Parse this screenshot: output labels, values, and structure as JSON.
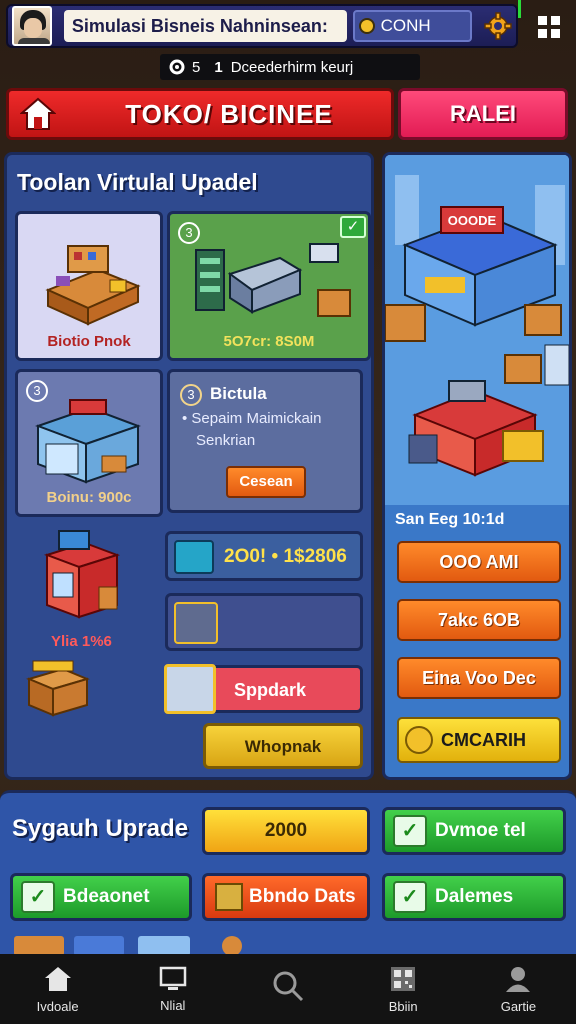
{
  "topbar": {
    "title": "Simulasi Bisneis Nahninsean:",
    "coin_value": "CONH",
    "icons": [
      "avatar",
      "gear-icon",
      "grid-icon"
    ]
  },
  "stats": {
    "level_value": "5",
    "info_number": "1",
    "info_text": "Dceederhirm keurj"
  },
  "tabs": {
    "main_label": "TOKO/ BICINEE",
    "right_label": "RALEI"
  },
  "left_panel": {
    "title": "Toolan Virtulal Upadel",
    "card_a_caption": "Biotio Pnok",
    "card_b_badge": "3",
    "card_b_caption": "5O7cr: 8S0M",
    "card_c_badge": "3",
    "card_c_caption": "Boinu: 900c",
    "card_d_number": "3",
    "card_d_title": "Bictula",
    "card_d_line1": "• Sepaim Maimickain",
    "card_d_line2": "Senkrian",
    "card_d_button": "Cesean",
    "shop_caption": "Ylia 1%6",
    "bar1_text": "2O0! • 1$2806",
    "bar3_text": "Sppdark",
    "bar4_text": "Whopnak"
  },
  "right_panel": {
    "sign_text": "OOODE",
    "stat_label": "San Eeg 10:1d",
    "button1": "OOO AMI",
    "button2": "7akc 6OB",
    "button3": "Eina Voo Dec",
    "button4": "CMCARIH"
  },
  "upgrade": {
    "title": "Sygauh Uprade",
    "btn_2000": "2000",
    "btn_green1": "Dvmoe tel",
    "btn_green2": "Bdeaonet",
    "btn_orange": "Bbndo Dats",
    "btn_green3": "Dalemes"
  },
  "nav": {
    "items": [
      {
        "label": "Ivdoale",
        "icon": "home-icon"
      },
      {
        "label": "Nlial",
        "icon": "monitor-icon"
      },
      {
        "label": "",
        "icon": "search-icon"
      },
      {
        "label": "Bbiin",
        "icon": "qr-icon"
      },
      {
        "label": "Gartie",
        "icon": "profile-icon"
      }
    ]
  },
  "colors": {
    "accent_red": "#e21c1c",
    "accent_pink": "#ff2d6a",
    "accent_orange": "#f06a14",
    "accent_green": "#2bb53a",
    "accent_yellow": "#f5c518",
    "panel_blue": "#2f4a8f"
  }
}
